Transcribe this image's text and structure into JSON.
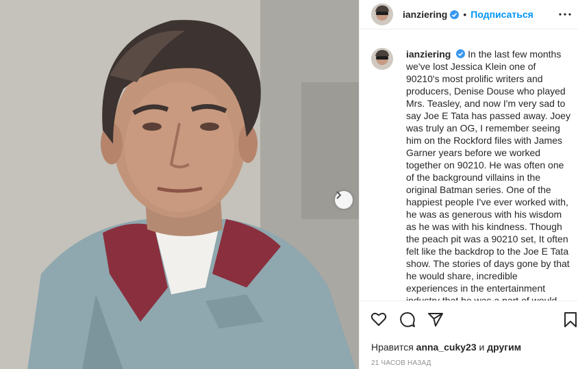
{
  "post": {
    "username": "ianziering",
    "follow_label": "Подписаться",
    "caption_text": "In the last few months we've lost Jessica Klein one of 90210's most prolific writers and producers, Denise Douse who played Mrs. Teasley, and now I'm very sad to say Joe E Tata has passed away. Joey was truly an OG, I remember seeing him on the Rockford files with James Garner years before we worked together on 90210. He was often one of the background villains in the original Batman series. One of the happiest people I've ever worked with, he was as generous with his wisdom as he was with his kindness. Though the peach pit was a 90210 set, It often felt like the backdrop to the Joe E Tata show. The stories of days gone by that he would share, incredible experiences in the entertainment industry that he was a part of would keep us all captivated",
    "likes_prefix": "Нравится",
    "likes_user": "anna_cuky23",
    "likes_and": "и",
    "likes_others": "другим",
    "timestamp": "21 часов назад"
  },
  "icons": {
    "verified": "verified-badge-icon",
    "more": "more-options-icon",
    "like": "heart-icon",
    "comment": "comment-icon",
    "share": "share-icon",
    "save": "bookmark-icon",
    "next": "chevron-right-icon"
  },
  "colors": {
    "accent": "#0095f6",
    "text": "#262626",
    "muted": "#8e8e8e",
    "shirt": "#8fa7ae",
    "collar": "#8a2f3e"
  }
}
